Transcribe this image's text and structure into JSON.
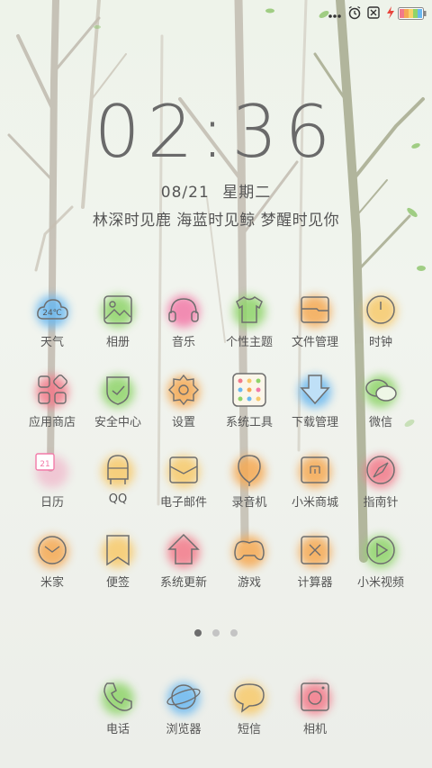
{
  "status": {
    "icons": [
      "more-icon",
      "alarm-icon",
      "close-box-icon",
      "charging-icon",
      "battery-icon"
    ]
  },
  "lock": {
    "time": "02:36",
    "date": "08/21",
    "weekday": "星期二",
    "motto": "林深时见鹿  海蓝时见鲸  梦醒时见你"
  },
  "weather_badge": "24℃",
  "calendar_badge": "21",
  "apps": [
    {
      "label": "天气",
      "icon": "weather-cloud-icon",
      "color": "#6ab8f0"
    },
    {
      "label": "相册",
      "icon": "gallery-icon",
      "color": "#8fd46a"
    },
    {
      "label": "音乐",
      "icon": "headphones-icon",
      "color": "#f27aa8"
    },
    {
      "label": "个性主题",
      "icon": "tshirt-icon",
      "color": "#8fd46a"
    },
    {
      "label": "文件管理",
      "icon": "folder-icon",
      "color": "#f5a953"
    },
    {
      "label": "时钟",
      "icon": "clock-icon",
      "color": "#f7c96a"
    },
    {
      "label": "应用商店",
      "icon": "app-store-icon",
      "color": "#f27a8a"
    },
    {
      "label": "安全中心",
      "icon": "shield-icon",
      "color": "#8fd46a"
    },
    {
      "label": "设置",
      "icon": "gear-icon",
      "color": "#f5a953"
    },
    {
      "label": "系统工具",
      "icon": "tools-grid-icon",
      "color": "#f7c96a"
    },
    {
      "label": "下载管理",
      "icon": "download-arrow-icon",
      "color": "#6ab8f0"
    },
    {
      "label": "微信",
      "icon": "wechat-icon",
      "color": "#8fd46a"
    },
    {
      "label": "日历",
      "icon": "calendar-icon",
      "color": "#f27aa8"
    },
    {
      "label": "QQ",
      "icon": "qq-penguin-icon",
      "color": "#f7c96a"
    },
    {
      "label": "电子邮件",
      "icon": "email-icon",
      "color": "#f7c96a"
    },
    {
      "label": "录音机",
      "icon": "microphone-icon",
      "color": "#f5a953"
    },
    {
      "label": "小米商城",
      "icon": "mi-store-bag-icon",
      "color": "#f5a953"
    },
    {
      "label": "指南针",
      "icon": "compass-icon",
      "color": "#f27a8a"
    },
    {
      "label": "米家",
      "icon": "mijia-icon",
      "color": "#f5a953"
    },
    {
      "label": "便签",
      "icon": "bookmark-note-icon",
      "color": "#f7c96a"
    },
    {
      "label": "系统更新",
      "icon": "update-house-icon",
      "color": "#f27a8a"
    },
    {
      "label": "游戏",
      "icon": "gamepad-icon",
      "color": "#f5a953"
    },
    {
      "label": "计算器",
      "icon": "calculator-icon",
      "color": "#f5a953"
    },
    {
      "label": "小米视频",
      "icon": "video-play-icon",
      "color": "#8fd46a"
    }
  ],
  "dock": [
    {
      "label": "电话",
      "icon": "phone-icon",
      "color": "#8fd46a"
    },
    {
      "label": "浏览器",
      "icon": "browser-planet-icon",
      "color": "#6ab8f0"
    },
    {
      "label": "短信",
      "icon": "message-bubble-icon",
      "color": "#f7c96a"
    },
    {
      "label": "相机",
      "icon": "camera-icon",
      "color": "#f27a8a"
    }
  ],
  "pager": {
    "pages": 3,
    "current": 1
  }
}
